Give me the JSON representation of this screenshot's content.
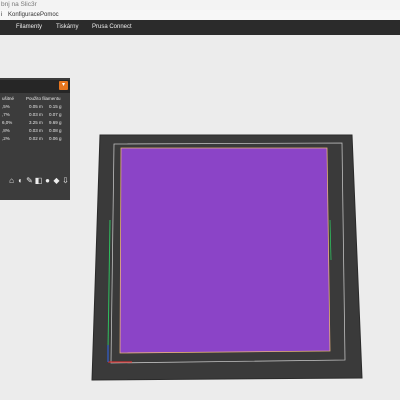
{
  "window": {
    "title": "bnj na Slic3r"
  },
  "menu": {
    "items": [
      "i",
      "Konfigurace",
      "Pomoc"
    ]
  },
  "tabs": [
    "Filamenty",
    "Tiskárny",
    "Prusa Connect"
  ],
  "stats_panel": {
    "columns": [
      "ušitné",
      "Použito filamentu"
    ],
    "rows": [
      {
        "c1": ",5%",
        "c2": "0.05 m",
        "c3": "0.15 g"
      },
      {
        "c1": ",7%",
        "c2": "0.03 m",
        "c3": "0.07 g"
      },
      {
        "c1": "6,0%",
        "c2": "3.25 m",
        "c3": "9.69 g"
      },
      {
        "c1": ",8%",
        "c2": "0.03 m",
        "c3": "0.08 g"
      },
      {
        "c1": ",2%",
        "c2": "0.02 m",
        "c3": "0.06 g"
      }
    ]
  },
  "toolbar": {
    "icons": [
      "spool-icon",
      "view-icon",
      "paint-icon",
      "layers-icon",
      "circle-icon",
      "gizmo-icon",
      "export-icon"
    ]
  },
  "colors": {
    "accent": "#e8761f",
    "bed": "#3a3a3a",
    "print": "#8b44c7",
    "background": "#ececec"
  }
}
